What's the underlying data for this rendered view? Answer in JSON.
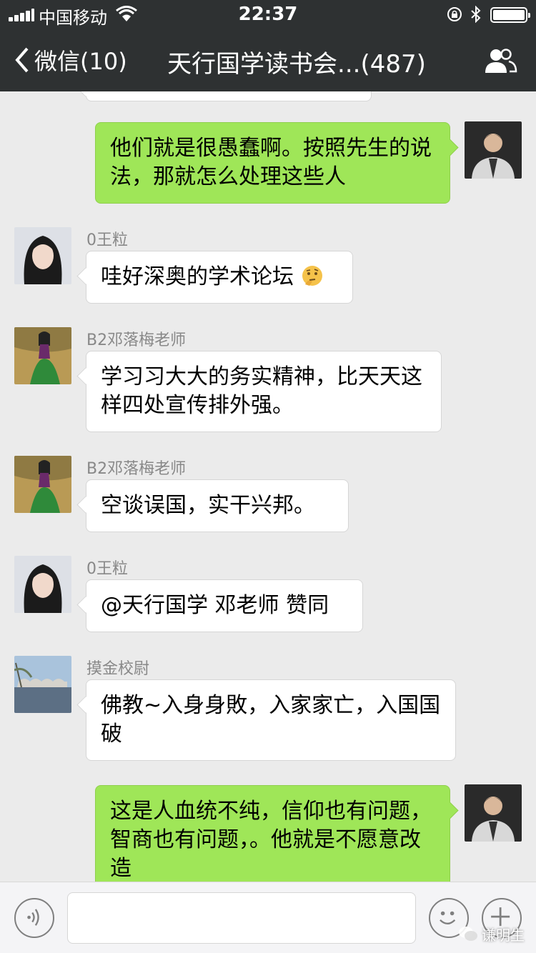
{
  "status_bar": {
    "carrier": "中国移动",
    "time": "22:37"
  },
  "nav": {
    "back_label": "微信(10)",
    "title": "天行国学读书会...(487)"
  },
  "messages": [
    {
      "from": "me",
      "text": "他们就是很愚蠢啊。按照先生的说法，那就怎么处理这些人"
    },
    {
      "from": "in",
      "sender": "0王粒",
      "text": "哇好深奥的学术论坛",
      "emoji": "thinking-face"
    },
    {
      "from": "in",
      "sender": "B2邓落梅老师",
      "text": "学习习大大的务实精神，比天天这样四处宣传排外强。"
    },
    {
      "from": "in",
      "sender": "B2邓落梅老师",
      "text": "空谈误国，实干兴邦。"
    },
    {
      "from": "in",
      "sender": "0王粒",
      "text": "@天行国学 邓老师  赞同"
    },
    {
      "from": "in",
      "sender": "摸金校尉",
      "text": "佛教~入身身敗，入家家亡，入国国破"
    },
    {
      "from": "me",
      "text": "这是人血统不纯，信仰也有问题，智商也有问题，。他就是不愿意改造"
    }
  ],
  "watermark": "谦明生",
  "colors": {
    "nav_bg": "#2e3132",
    "chat_bg": "#ebebeb",
    "my_bubble": "#9fe658",
    "other_bubble": "#ffffff"
  }
}
